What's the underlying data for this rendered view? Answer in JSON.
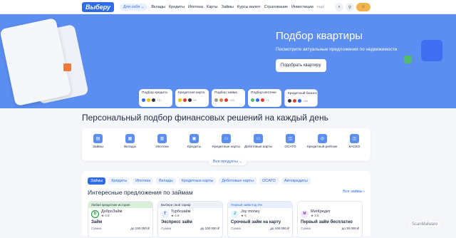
{
  "header": {
    "logo": "Выберу",
    "for_you": "Для себя ⌄",
    "nav": [
      "Вклады",
      "Кредиты",
      "Ипотека",
      "Карты",
      "Займы",
      "Курсы валют",
      "Страхование",
      "Инвестиции"
    ],
    "more": "ещё"
  },
  "hero": {
    "title": "Подбор квартиры",
    "subtitle": "Посмотрите актуальные предложения по недвижимости",
    "cta": "Подобрать квартиру"
  },
  "categories": [
    {
      "label": "Подбор кредита",
      "count": "+17"
    },
    {
      "label": "Кредитная карта",
      "count": "+4"
    },
    {
      "label": "Подбор займа",
      "count": "+20"
    },
    {
      "label": "Подбор ипотеки",
      "count": "+4"
    },
    {
      "label": "Кредитный бизнес",
      "count": "+16"
    }
  ],
  "section_title": "Персональный подбор финансовых решений на каждый день",
  "quick": [
    {
      "label": "Займы",
      "icon": "loan-icon"
    },
    {
      "label": "Вклады",
      "icon": "deposit-icon"
    },
    {
      "label": "Ипотека",
      "icon": "mortgage-icon"
    },
    {
      "label": "Кредиты",
      "icon": "credit-icon"
    },
    {
      "label": "Кредитные карты",
      "icon": "card-icon"
    },
    {
      "label": "Дебетовые карты",
      "icon": "debit-card-icon"
    },
    {
      "label": "ОСАГО",
      "icon": "car-icon"
    },
    {
      "label": "Кредитный рейтинг",
      "icon": "rating-icon"
    },
    {
      "label": "КАСКО",
      "icon": "kasko-icon"
    }
  ],
  "more_products": "Все продукты ⌄",
  "offers": {
    "tabs": [
      "Займы",
      "Кредиты",
      "Ипотека",
      "Вклады",
      "Кредитные карты",
      "Дебетовые карты",
      "ОСАГО",
      "Автокредиты"
    ],
    "title": "Интересные предложения по займам",
    "all_link": "Все займы ›",
    "cards": [
      {
        "badge": "Любая кредитная история",
        "name": "ДоброЗайм",
        "rating": "★ 4.8",
        "desc": "Займ",
        "row_label": "Сумма",
        "row_value": "до 100 000 ₽",
        "logo": "D",
        "logo_bg": "#1e8f3a"
      },
      {
        "badge": "Выбери свой тариф",
        "name": "Турбозайм",
        "rating": "★ 4.8",
        "desc": "Экспресс займ",
        "row_label": "Сумма",
        "row_value": "до 100 000 ₽",
        "logo": "T",
        "logo_bg": "#2f6bea"
      },
      {
        "badge": "Первый займ под 0%",
        "name": "Joy money",
        "rating": "★ 5",
        "desc": "Срочный займ на карту",
        "row_label": "Сумма",
        "row_value": "до 100 000 ₽",
        "logo": "J",
        "logo_bg": "#6cc3f0"
      },
      {
        "badge": "",
        "name": "МигКредит",
        "rating": "★ 3.9",
        "desc": "Первый займ бесплатно",
        "row_label": "Сумма",
        "row_value": "до 30 000 ₽",
        "logo": "M",
        "logo_bg": "#7a2fb0"
      }
    ]
  },
  "watermark": "ScanMalware"
}
